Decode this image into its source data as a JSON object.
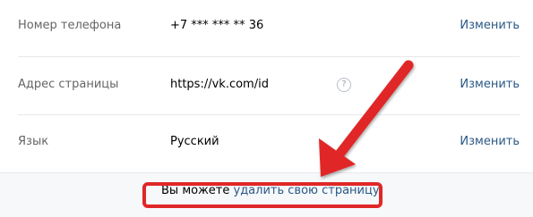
{
  "settings": {
    "rows": [
      {
        "label": "Номер телефона",
        "value": "+7 *** *** ** 36",
        "action": "Изменить"
      },
      {
        "label": "Адрес страницы",
        "value": "https://vk.com/id",
        "action": "Изменить",
        "help": "?"
      },
      {
        "label": "Язык",
        "value": "Русский",
        "action": "Изменить"
      }
    ]
  },
  "footer": {
    "prefix": "Вы можете",
    "delete_link": "удалить свою страницу",
    "suffix": "."
  },
  "colors": {
    "annotation_red": "#e02727",
    "link_blue": "#2a5885"
  },
  "icons": {
    "help": "question-circle-icon",
    "annotation": "red-arrow-icon"
  }
}
